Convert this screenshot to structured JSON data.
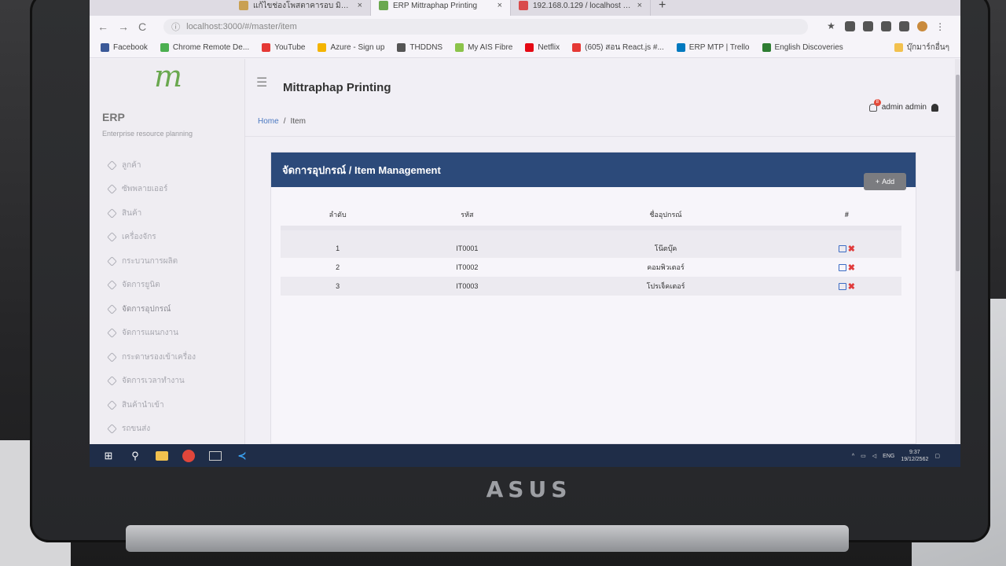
{
  "browser": {
    "tabs": [
      {
        "label": "แก้ไขช่องโพสตาคารอบ มิตรภาพพริ้นต์...",
        "fav_color": "#c9a052"
      },
      {
        "label": "ERP Mittraphap Printing",
        "fav_color": "#6aa84f",
        "active": true
      },
      {
        "label": "192.168.0.129 / localhost / revels",
        "fav_color": "#d94b4b"
      }
    ],
    "tab_close": "×",
    "new_tab": "+",
    "nav": {
      "back": "←",
      "forward": "→",
      "reload": "C"
    },
    "address": "localhost:3000/#/master/item",
    "bookmarks": [
      {
        "label": "Facebook",
        "color": "#3b5998"
      },
      {
        "label": "Chrome Remote De...",
        "color": "#4caf50"
      },
      {
        "label": "YouTube",
        "color": "#e53935"
      },
      {
        "label": "Azure - Sign up",
        "color": "#f4b400"
      },
      {
        "label": "THDDNS",
        "color": "#555555"
      },
      {
        "label": "My AIS Fibre",
        "color": "#8bc34a"
      },
      {
        "label": "Netflix",
        "color": "#e50914"
      },
      {
        "label": "(605) สอน React.js #...",
        "color": "#e53935"
      },
      {
        "label": "ERP MTP | Trello",
        "color": "#0079bf"
      },
      {
        "label": "English Discoveries",
        "color": "#2e7d32"
      }
    ],
    "other_bookmarks": "บุ๊กมาร์กอื่นๆ"
  },
  "sidebar": {
    "logo": "m",
    "title": "ERP",
    "subtitle": "Enterprise resource planning",
    "items": [
      {
        "label": "ลูกค้า"
      },
      {
        "label": "ซัพพลายเออร์"
      },
      {
        "label": "สินค้า"
      },
      {
        "label": "เครื่องจักร"
      },
      {
        "label": "กระบวนการผลิต"
      },
      {
        "label": "จัดการยูนิต"
      },
      {
        "label": "จัดการอุปกรณ์",
        "active": true
      },
      {
        "label": "จัดการแผนกงาน"
      },
      {
        "label": "กระดาษรองเข้าเครื่อง"
      },
      {
        "label": "จัดการเวลาทำงาน"
      },
      {
        "label": "สินค้านำเข้า"
      },
      {
        "label": "รถขนส่ง"
      }
    ]
  },
  "header": {
    "menu_icon": "☰",
    "brand": "Mittraphap Printing",
    "notification_count": "8",
    "user": "admin admin"
  },
  "breadcrumb": {
    "home": "Home",
    "sep": "/",
    "current": "Item"
  },
  "panel": {
    "title": "จัดการอุปกรณ์ / Item Management",
    "add_label": "Add",
    "add_icon": "+",
    "columns": [
      "ลำดับ",
      "รหัส",
      "ชื่ออุปกรณ์",
      "#"
    ],
    "rows": [
      {
        "no": "1",
        "code": "IT0001",
        "name": "โน๊ตบุ๊ค"
      },
      {
        "no": "2",
        "code": "IT0002",
        "name": "คอมพิวเตอร์"
      },
      {
        "no": "3",
        "code": "IT0003",
        "name": "โปรเจ็คเตอร์"
      }
    ],
    "delete_glyph": "✖"
  },
  "taskbar": {
    "start": "⊞",
    "search": "⚲",
    "lang": "ENG",
    "time": "9:37",
    "date": "19/12/2562"
  },
  "laptop_brand": "ASUS"
}
